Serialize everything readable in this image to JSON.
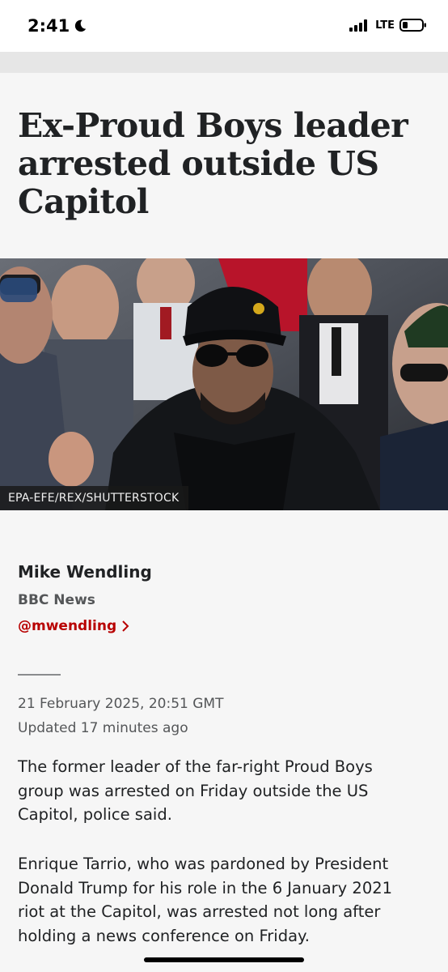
{
  "status_bar": {
    "time": "2:41",
    "network": "LTE",
    "icons": [
      "moon-icon",
      "signal-icon",
      "battery-icon"
    ]
  },
  "article": {
    "headline": "Ex-Proud Boys leader arrested outside US Capitol",
    "image": {
      "credit": "EPA-EFE/REX/SHUTTERSTOCK"
    },
    "byline": {
      "author": "Mike Wendling",
      "organisation": "BBC News",
      "handle": "@mwendling"
    },
    "published": "21 February 2025, 20:51 GMT",
    "updated": "Updated 17 minutes ago",
    "paragraphs": [
      "The former leader of the far-right Proud Boys group was arrested on Friday outside the US Capitol, police said.",
      "Enrique Tarrio, who was pardoned by President Donald Trump for his role in the 6 January 2021 riot at the Capitol, was arrested not long after holding a news conference on Friday."
    ]
  },
  "colors": {
    "accent_link": "#b80000",
    "background": "#f6f6f6",
    "text": "#202224",
    "secondary_text": "#545658"
  }
}
